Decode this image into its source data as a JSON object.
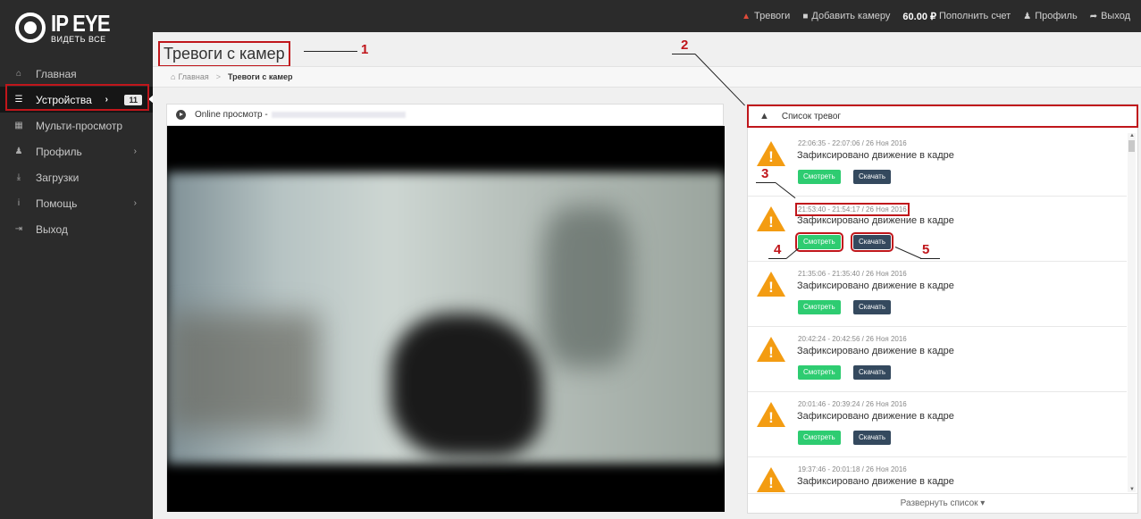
{
  "logo": {
    "main": "IP EYE",
    "sub": "ВИДЕТЬ ВСЕ"
  },
  "sidebar": {
    "items": [
      {
        "label": "Главная",
        "icon": "home-icon"
      },
      {
        "label": "Устройства",
        "icon": "list-icon",
        "badge": "11",
        "active": true
      },
      {
        "label": "Мульти-просмотр",
        "icon": "grid-icon"
      },
      {
        "label": "Профиль",
        "icon": "user-icon"
      },
      {
        "label": "Загрузки",
        "icon": "download-icon"
      },
      {
        "label": "Помощь",
        "icon": "info-icon"
      },
      {
        "label": "Выход",
        "icon": "logout-icon"
      }
    ]
  },
  "topbar": {
    "alarms": "Тревоги",
    "add_camera": "Добавить камеру",
    "balance": "60.00 ₽",
    "topup": "Пополнить счет",
    "profile": "Профиль",
    "logout": "Выход"
  },
  "page": {
    "title": "Тревоги с камер",
    "breadcrumb_home": "Главная",
    "breadcrumb_current": "Тревоги с камер"
  },
  "video": {
    "header": "Online просмотр -"
  },
  "alarm_list": {
    "title": "Список тревог",
    "expand": "Развернуть список",
    "view_label": "Смотреть",
    "download_label": "Скачать",
    "items": [
      {
        "time": "22:06:35 - 22:07:06 / 26 Ноя 2016",
        "message": "Зафиксировано движение в кадре"
      },
      {
        "time": "21:53:40 - 21:54:17 / 26 Ноя 2016",
        "message": "Зафиксировано движение в кадре"
      },
      {
        "time": "21:35:06 - 21:35:40 / 26 Ноя 2016",
        "message": "Зафиксировано движение в кадре"
      },
      {
        "time": "20:42:24 - 20:42:56 / 26 Ноя 2016",
        "message": "Зафиксировано движение в кадре"
      },
      {
        "time": "20:01:46 - 20:39:24 / 26 Ноя 2016",
        "message": "Зафиксировано движение в кадре"
      },
      {
        "time": "19:37:46 - 20:01:18 / 26 Ноя 2016",
        "message": "Зафиксировано движение в кадре"
      }
    ]
  },
  "annotations": [
    "1",
    "2",
    "3",
    "4",
    "5"
  ],
  "colors": {
    "accent_red": "#c0161b",
    "view_green": "#2ecc71",
    "download_navy": "#34495e",
    "warning_orange": "#f39c12"
  }
}
